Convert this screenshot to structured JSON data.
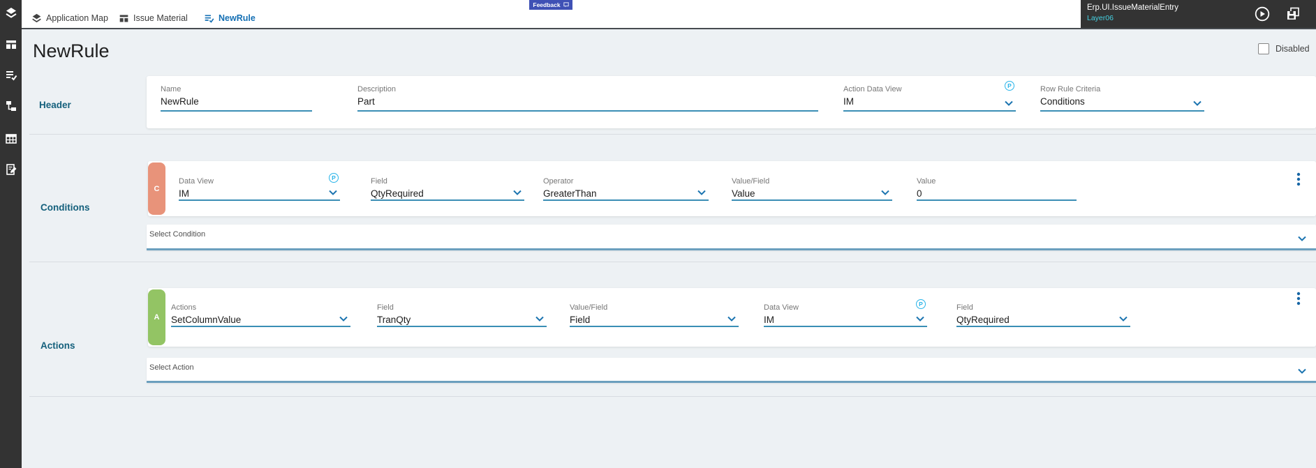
{
  "topbar": {
    "tabs": [
      {
        "label": "Application Map"
      },
      {
        "label": "Issue Material"
      },
      {
        "label": "NewRule"
      }
    ],
    "feedback": {
      "label": "Feedback"
    },
    "app_info": {
      "name": "Erp.UI.IssueMaterialEntry",
      "layer": "Layer06"
    }
  },
  "page": {
    "title": "NewRule",
    "disabled_checkbox": {
      "label": "Disabled",
      "checked": false
    }
  },
  "icons": {
    "peek": "P"
  },
  "sections": {
    "header": {
      "label": "Header",
      "fields": {
        "name": {
          "label": "Name",
          "value": "NewRule"
        },
        "description": {
          "label": "Description",
          "value": "Part"
        },
        "action_data_view": {
          "label": "Action Data View",
          "value": "IM"
        },
        "row_rule_criteria": {
          "label": "Row Rule Criteria",
          "value": "Conditions"
        }
      }
    },
    "conditions": {
      "label": "Conditions",
      "badge": "C",
      "fields": {
        "data_view": {
          "label": "Data View",
          "value": "IM"
        },
        "field": {
          "label": "Field",
          "value": "QtyRequired"
        },
        "operator": {
          "label": "Operator",
          "value": "GreaterThan"
        },
        "value_field": {
          "label": "Value/Field",
          "value": "Value"
        },
        "value": {
          "label": "Value",
          "value": "0"
        }
      },
      "select_placeholder": "Select Condition"
    },
    "actions": {
      "label": "Actions",
      "badge": "A",
      "fields": {
        "actions": {
          "label": "Actions",
          "value": "SetColumnValue"
        },
        "field": {
          "label": "Field",
          "value": "TranQty"
        },
        "value_field": {
          "label": "Value/Field",
          "value": "Field"
        },
        "data_view": {
          "label": "Data View",
          "value": "IM"
        },
        "field2": {
          "label": "Field",
          "value": "QtyRequired"
        }
      },
      "select_placeholder": "Select Action"
    }
  },
  "colors": {
    "accent_underline": "#3a8eb5",
    "badge_condition": "#e8937a",
    "badge_action": "#93c464",
    "peek_icon": "#29b4e9",
    "feedback_bg": "#3f51b5",
    "layer_text": "#45d1e2",
    "section_label": "#14607c",
    "active_tab": "#1570b4",
    "dark_bar": "#333333"
  }
}
